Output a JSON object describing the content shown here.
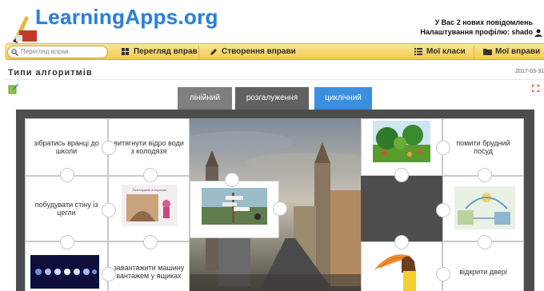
{
  "header": {
    "logo_text": "LearningApps.org",
    "messages_text": "У Вас 2 нових повідомлень",
    "profile_text": "Налаштування профілю: shado"
  },
  "nav": {
    "search_placeholder": "Перегляд вправ",
    "browse_label": "Перегляд вправ",
    "create_label": "Створення вправи",
    "classes_label": "Мої класи",
    "apps_label": "Мої вправи"
  },
  "page": {
    "title": "Типи алгоритмів",
    "date": "2017-03-31"
  },
  "tabs": [
    {
      "label": "лінійний"
    },
    {
      "label": "розгалуження"
    },
    {
      "label": "циклічний"
    }
  ],
  "cards": {
    "wake_up": "зібратись вранці до школи",
    "pull_bucket": "витягнути відро води з колодязя",
    "wash_dishes": "помити брудний посуд",
    "build_wall": "побудувати стіну із цегли",
    "load_truck": "завантажити машину вантажем у ящиках",
    "open_doors": "відкрити двері"
  },
  "images": {
    "slide_caption": "Розгалужені алгоритми"
  },
  "colors": {
    "logo_blue": "#2a7fd8",
    "navbar_yellow": "#f2cb4d",
    "tab_active": "#3a8fe0",
    "board_gray": "#4d4d4d"
  }
}
